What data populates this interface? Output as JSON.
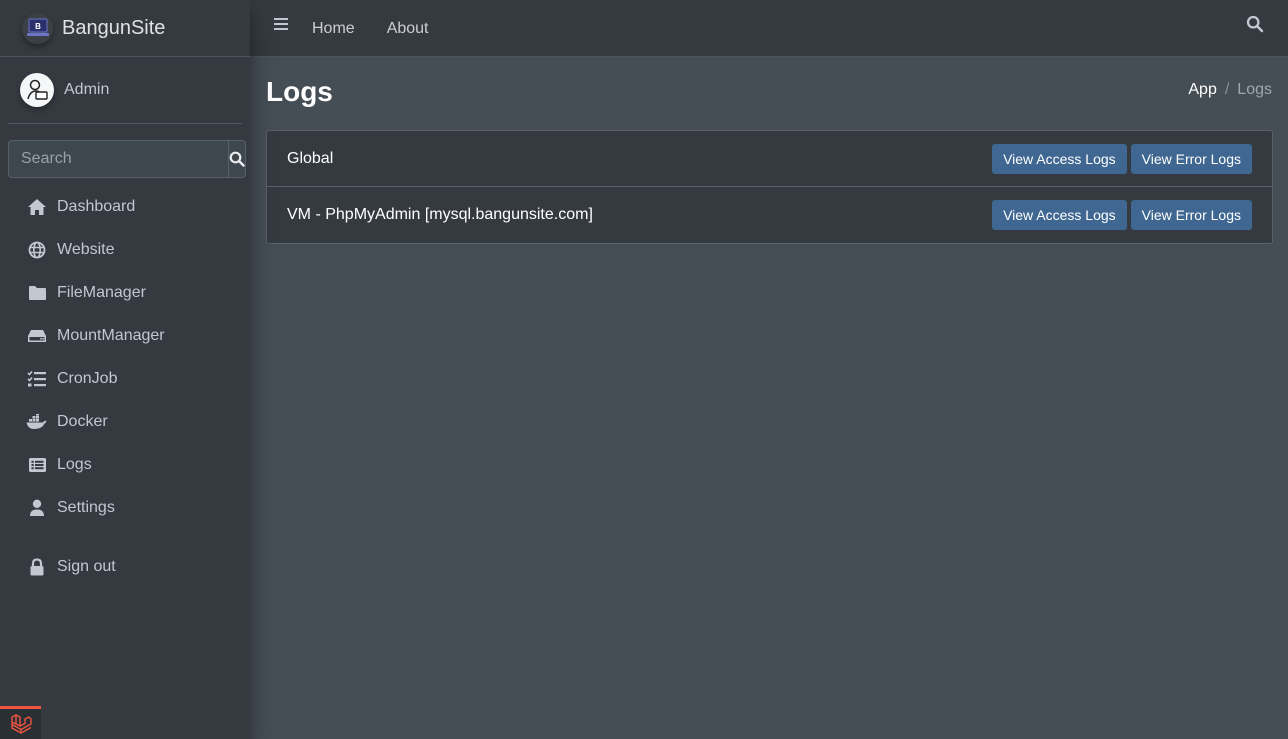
{
  "brand": {
    "name": "BangunSite",
    "logo_letter": "B"
  },
  "user": {
    "name": "Admin"
  },
  "sidebar": {
    "search_placeholder": "Search",
    "items": [
      {
        "label": "Dashboard",
        "icon": "home-icon"
      },
      {
        "label": "Website",
        "icon": "globe-icon"
      },
      {
        "label": "FileManager",
        "icon": "folder-icon"
      },
      {
        "label": "MountManager",
        "icon": "hdd-icon"
      },
      {
        "label": "CronJob",
        "icon": "tasks-icon"
      },
      {
        "label": "Docker",
        "icon": "docker-icon"
      },
      {
        "label": "Logs",
        "icon": "list-alt-icon"
      },
      {
        "label": "Settings",
        "icon": "user-icon"
      }
    ],
    "signout": {
      "label": "Sign out",
      "icon": "lock-icon"
    }
  },
  "topnav": {
    "links": [
      "Home",
      "About"
    ]
  },
  "page": {
    "title": "Logs",
    "breadcrumb": {
      "parent": "App",
      "separator": "/",
      "current": "Logs"
    }
  },
  "logs": [
    {
      "name": "Global",
      "access_label": "View Access Logs",
      "error_label": "View Error Logs"
    },
    {
      "name": "VM - PhpMyAdmin [mysql.bangunsite.com]",
      "access_label": "View Access Logs",
      "error_label": "View Error Logs"
    }
  ],
  "colors": {
    "sidebar": "#343a40",
    "content": "#454d55",
    "button": "#3f6791",
    "laravel": "#f05340"
  }
}
